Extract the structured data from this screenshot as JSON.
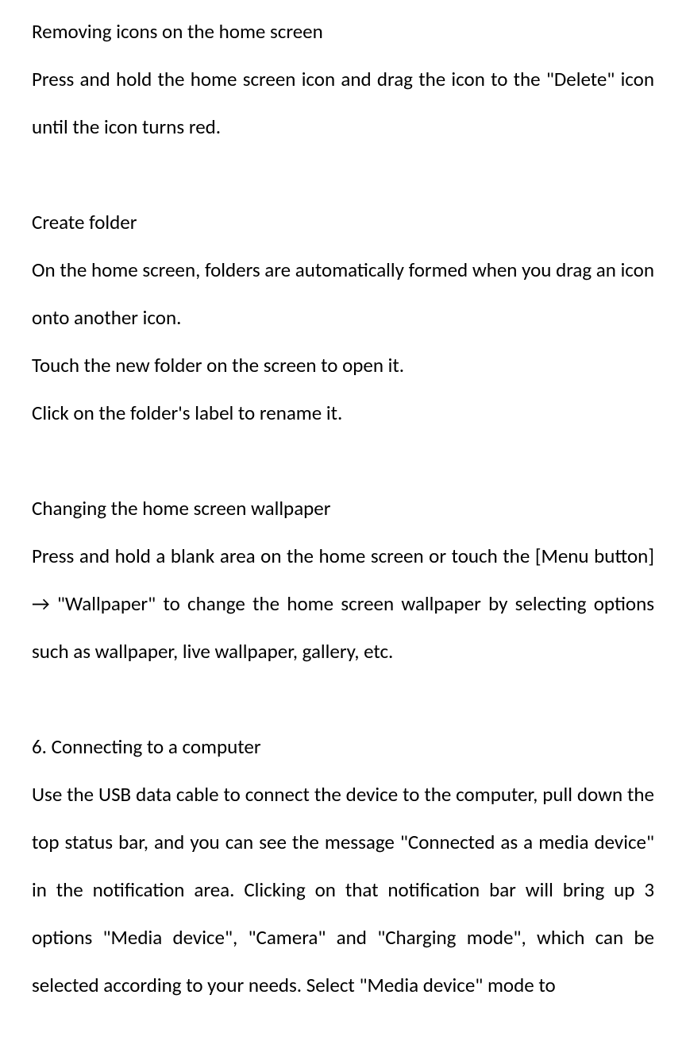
{
  "section1": {
    "heading": "Removing icons on the home screen",
    "body": "Press and hold the home screen icon and drag the icon to the \"Delete\" icon until the icon turns red."
  },
  "section2": {
    "heading": "Create folder",
    "body1": "On the home screen, folders are automatically formed when you drag an icon onto another icon.",
    "body2": "Touch the new folder on the screen to open it.",
    "body3": "Click on the folder's label to rename it."
  },
  "section3": {
    "heading": "Changing the home screen wallpaper",
    "body": "Press and hold a blank area on the home screen or touch the [Menu button] → \"Wallpaper\" to change the home screen wallpaper by selecting options such as wallpaper, live wallpaper, gallery, etc."
  },
  "section4": {
    "heading": "6. Connecting to a computer",
    "body": "Use the USB data cable to connect the device to the computer, pull down the top status bar, and you can see the message \"Connected as a media device\" in the notification area. Clicking on that notification bar will bring up 3 options \"Media device\", \"Camera\" and \"Charging mode\", which can be selected according to your needs. Select \"Media device\" mode to"
  }
}
